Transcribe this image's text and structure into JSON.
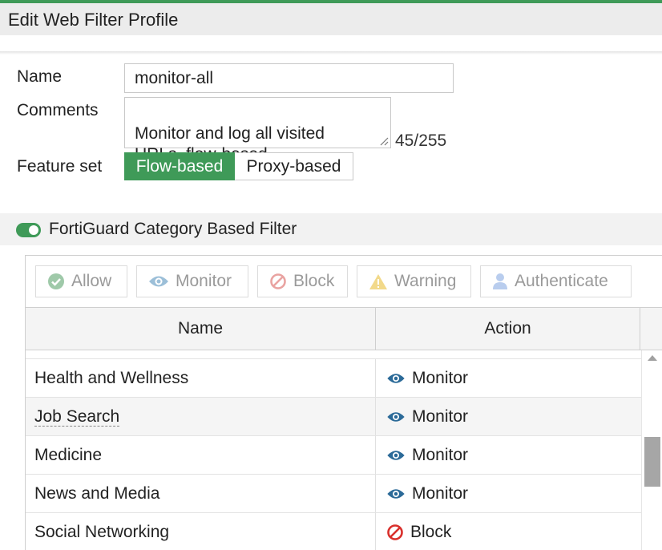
{
  "header": {
    "title": "Edit Web Filter Profile"
  },
  "form": {
    "name_label": "Name",
    "name_value": "monitor-all",
    "comments_label": "Comments",
    "comments_value": "Monitor and log all visited\nURLs, flow-based.",
    "comments_count": "45/255",
    "feature_set_label": "Feature set",
    "feature_options": [
      "Flow-based",
      "Proxy-based"
    ],
    "feature_selected": "Flow-based"
  },
  "section": {
    "title": "FortiGuard Category Based Filter",
    "enabled": true
  },
  "toolbar": {
    "allow": "Allow",
    "monitor": "Monitor",
    "block": "Block",
    "warning": "Warning",
    "authenticate": "Authenticate"
  },
  "table": {
    "columns": [
      "Name",
      "Action"
    ],
    "rows": [
      {
        "name": "Health and Wellness",
        "action": "Monitor"
      },
      {
        "name": "Job Search",
        "action": "Monitor"
      },
      {
        "name": "Medicine",
        "action": "Monitor"
      },
      {
        "name": "News and Media",
        "action": "Monitor"
      },
      {
        "name": "Social Networking",
        "action": "Block"
      }
    ]
  },
  "colors": {
    "accent": "#3f9a58",
    "monitor_icon": "#2b6a98",
    "block_icon": "#d9302c"
  },
  "icons": {
    "allow": "check-circle-icon",
    "monitor": "eye-icon",
    "block": "no-entry-icon",
    "warning": "warning-triangle-icon",
    "authenticate": "user-icon"
  }
}
